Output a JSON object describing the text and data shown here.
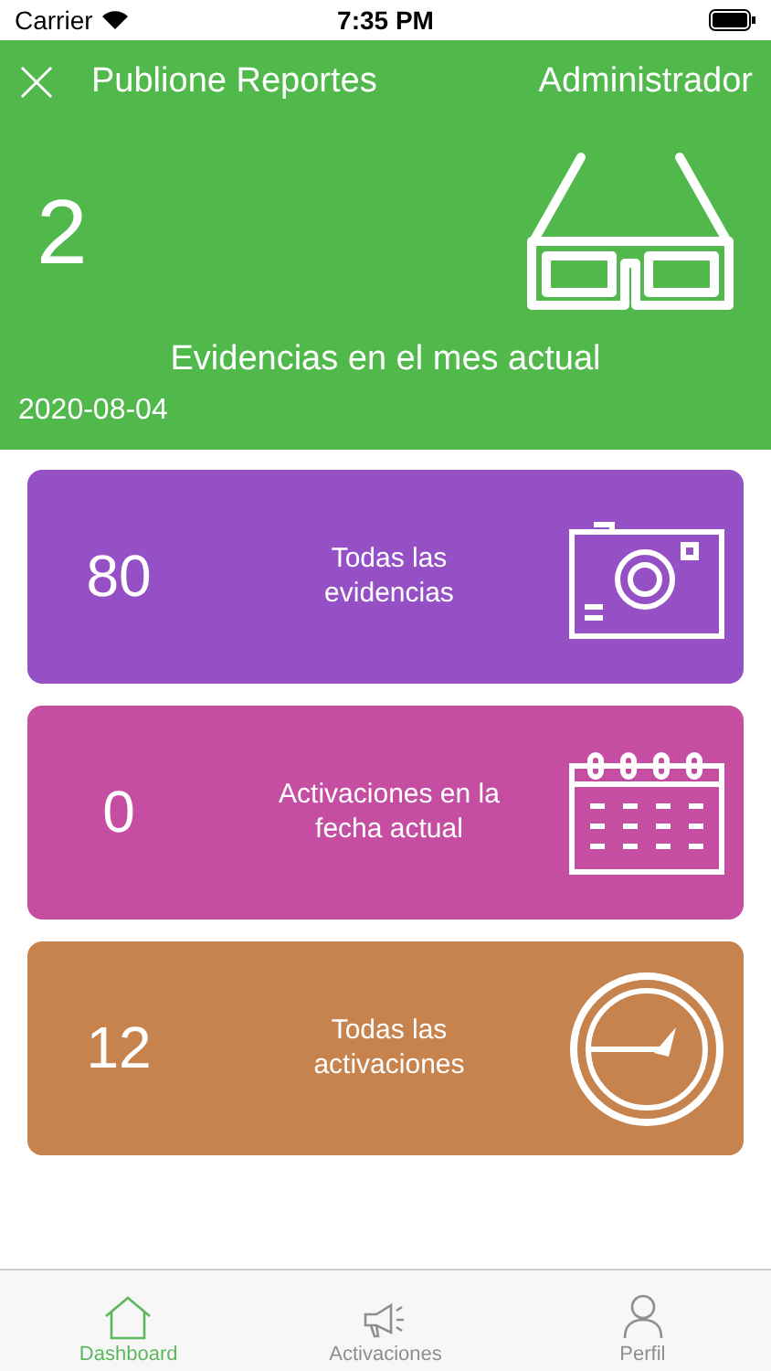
{
  "status_bar": {
    "carrier": "Carrier",
    "time": "7:35 PM"
  },
  "header": {
    "title": "Publione Reportes",
    "user": "Administrador",
    "count": "2",
    "caption": "Evidencias en el mes actual",
    "date": "2020-08-04"
  },
  "cards": [
    {
      "kind": "camera",
      "count": "80",
      "label": "Todas las evidencias",
      "color": "#9450c4"
    },
    {
      "kind": "calendar",
      "count": "0",
      "label": "Activaciones en la fecha actual",
      "color": "#c54ea3"
    },
    {
      "kind": "gauge",
      "count": "12",
      "label": "Todas las activaciones",
      "color": "#c6834e"
    }
  ],
  "tabs": [
    {
      "kind": "home",
      "label": "Dashboard",
      "selected": true
    },
    {
      "kind": "megaphone",
      "label": "Activaciones",
      "selected": false
    },
    {
      "kind": "person",
      "label": "Perfil",
      "selected": false
    }
  ]
}
